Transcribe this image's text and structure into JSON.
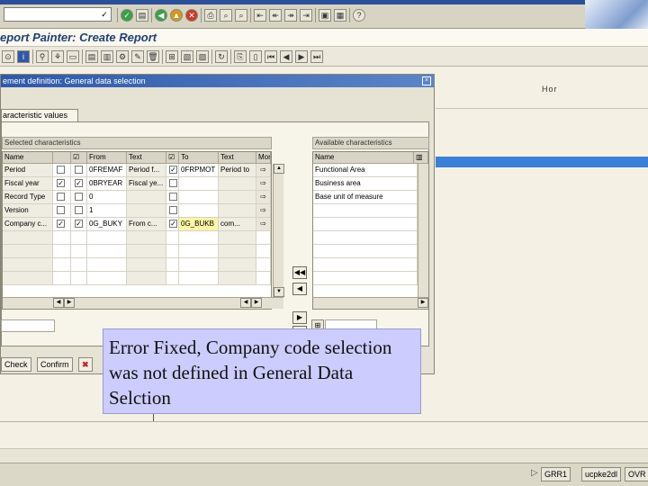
{
  "app": {
    "title": "eport Painter: Create Report",
    "right_header_text": "Hor"
  },
  "system_toolbar": {
    "command_field_value": "",
    "command_field_icon": "✓",
    "icons": [
      "enter-icon",
      "save-icon",
      "back-icon",
      "exit-icon",
      "cancel-icon",
      "print-icon",
      "find-icon",
      "find-next-icon",
      "first-page-icon",
      "prev-page-icon",
      "next-page-icon",
      "last-page-icon",
      "new-session-icon",
      "shortcut-icon",
      "help-icon"
    ]
  },
  "right_header": {
    "text": "Hor"
  },
  "dialog": {
    "title": "ement definition: General data selection",
    "close_glyph": "×",
    "right_info": "Hor"
  },
  "tab": {
    "label": "aracteristic values"
  },
  "selected_grid": {
    "title": "Selected characteristics",
    "columns": [
      "Name",
      "",
      "From",
      "Text",
      "To",
      "Text",
      "More"
    ],
    "rows": [
      {
        "name": "Period",
        "checked": false,
        "from": "0FREMAF",
        "from_text": "Period f...",
        "to_checked": true,
        "to": "0FRPMOT",
        "to_text": "Period to",
        "more": "⇨"
      },
      {
        "name": "Fiscal year",
        "checked": true,
        "from": "0BRYEAR",
        "from_text": "Fiscal ye...",
        "to_checked": false,
        "to": "",
        "to_text": "",
        "more": "⇨"
      },
      {
        "name": "Record Type",
        "checked": false,
        "from": "0",
        "from_text": "",
        "to_checked": false,
        "to": "",
        "to_text": "",
        "more": "⇨"
      },
      {
        "name": "Version",
        "checked": false,
        "from": "1",
        "from_text": "",
        "to_checked": false,
        "to": "",
        "to_text": "",
        "more": "⇨"
      },
      {
        "name": "Company c...",
        "checked": true,
        "from": "0G_BUKY",
        "from_text": "From c...",
        "to_checked": true,
        "to": "0G_BUKB",
        "to_text": "com...",
        "more": "⇨"
      }
    ]
  },
  "available_grid": {
    "title": "Available characteristics",
    "columns": [
      "Name"
    ],
    "rows": [
      "Functional Area",
      "Business area",
      "Base unit of measure"
    ]
  },
  "footer_buttons": {
    "check": "Check",
    "confirm": "Confirm",
    "cancel_glyph": "✖"
  },
  "callout": {
    "text": "Error Fixed, Company code selection was not defined in General Data Selction"
  },
  "status_bar": {
    "system": "GRR1",
    "server": "ucpke2dl",
    "mode": "OVR",
    "arrow": "▷"
  }
}
